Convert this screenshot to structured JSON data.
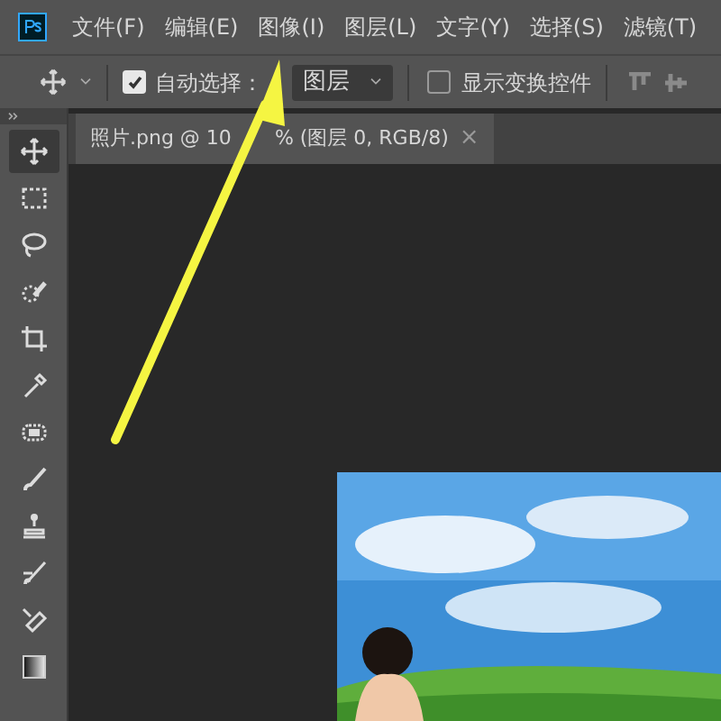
{
  "menu": [
    "文件(F)",
    "编辑(E)",
    "图像(I)",
    "图层(L)",
    "文字(Y)",
    "选择(S)",
    "滤镜(T)"
  ],
  "options_bar": {
    "auto_select": {
      "label": "自动选择：",
      "checked": true
    },
    "target": {
      "value": "图层"
    },
    "show_transform": {
      "label": "显示变换控件",
      "checked": false
    }
  },
  "document_tab": {
    "title_parts": [
      "照片.png @ 10",
      "% (图层 0, RGB/8)"
    ],
    "close": "×"
  },
  "tools": [
    {
      "kind": "move",
      "selected": true
    },
    {
      "kind": "marquee",
      "selected": false
    },
    {
      "kind": "lasso",
      "selected": false
    },
    {
      "kind": "quick-select",
      "selected": false
    },
    {
      "kind": "crop",
      "selected": false
    },
    {
      "kind": "eyedropper",
      "selected": false
    },
    {
      "kind": "healing",
      "selected": false
    },
    {
      "kind": "brush",
      "selected": false
    },
    {
      "kind": "stamp",
      "selected": false
    },
    {
      "kind": "history-brush",
      "selected": false
    },
    {
      "kind": "eraser",
      "selected": false
    },
    {
      "kind": "gradient",
      "selected": false
    }
  ]
}
